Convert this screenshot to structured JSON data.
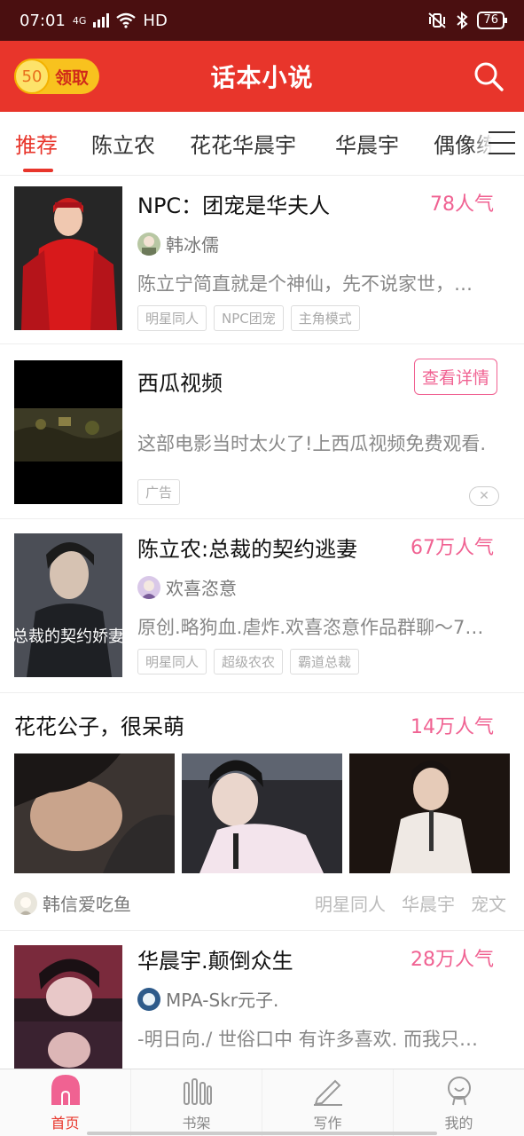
{
  "status_bar": {
    "time": "07:01",
    "network": "4G",
    "hd": "HD",
    "battery": "76"
  },
  "header": {
    "coin_value": "50",
    "claim_label": "领取",
    "title": "话本小说"
  },
  "tabs": [
    {
      "label": "推荐"
    },
    {
      "label": "陈立农"
    },
    {
      "label": "花花华晨宇"
    },
    {
      "label": "华晨宇"
    },
    {
      "label": "偶像练"
    }
  ],
  "feed": {
    "book1": {
      "title": "NPC：团宠是华夫人",
      "popularity": "78人气",
      "author": "韩冰儒",
      "desc": "陈立宁简直就是个神仙，先不说家世，…",
      "tags": [
        "明星同人",
        "NPC团宠",
        "主角模式"
      ]
    },
    "ad": {
      "title": "西瓜视频",
      "button": "查看详情",
      "desc": "这部电影当时太火了!上西瓜视频免费观看.",
      "badge": "广告"
    },
    "book2": {
      "title": "陈立农:总裁的契约逃妻",
      "popularity": "67万人气",
      "author": "欢喜恣意",
      "desc": "原创.略狗血.虐炸.欢喜恣意作品群聊～7…",
      "tags": [
        "明星同人",
        "超级农农",
        "霸道总裁"
      ],
      "cover_text": "总裁的契约娇妻"
    },
    "gallery": {
      "title": "花花公子，很呆萌",
      "popularity": "14万人气",
      "author": "韩信爱吃鱼",
      "tags": [
        "明星同人",
        "华晨宇",
        "宠文"
      ]
    },
    "book3": {
      "title": "华晨宇.颠倒众生",
      "popularity": "28万人气",
      "author": "MPA-Skr元子.",
      "desc": "-明日向./  世俗口中 有许多喜欢. 而我只…"
    }
  },
  "bottom_nav": [
    {
      "label": "首页"
    },
    {
      "label": "书架"
    },
    {
      "label": "写作"
    },
    {
      "label": "我的"
    }
  ],
  "colors": {
    "brand": "#e8352b",
    "popularity": "#f06292",
    "coin": "#f8c21e"
  }
}
